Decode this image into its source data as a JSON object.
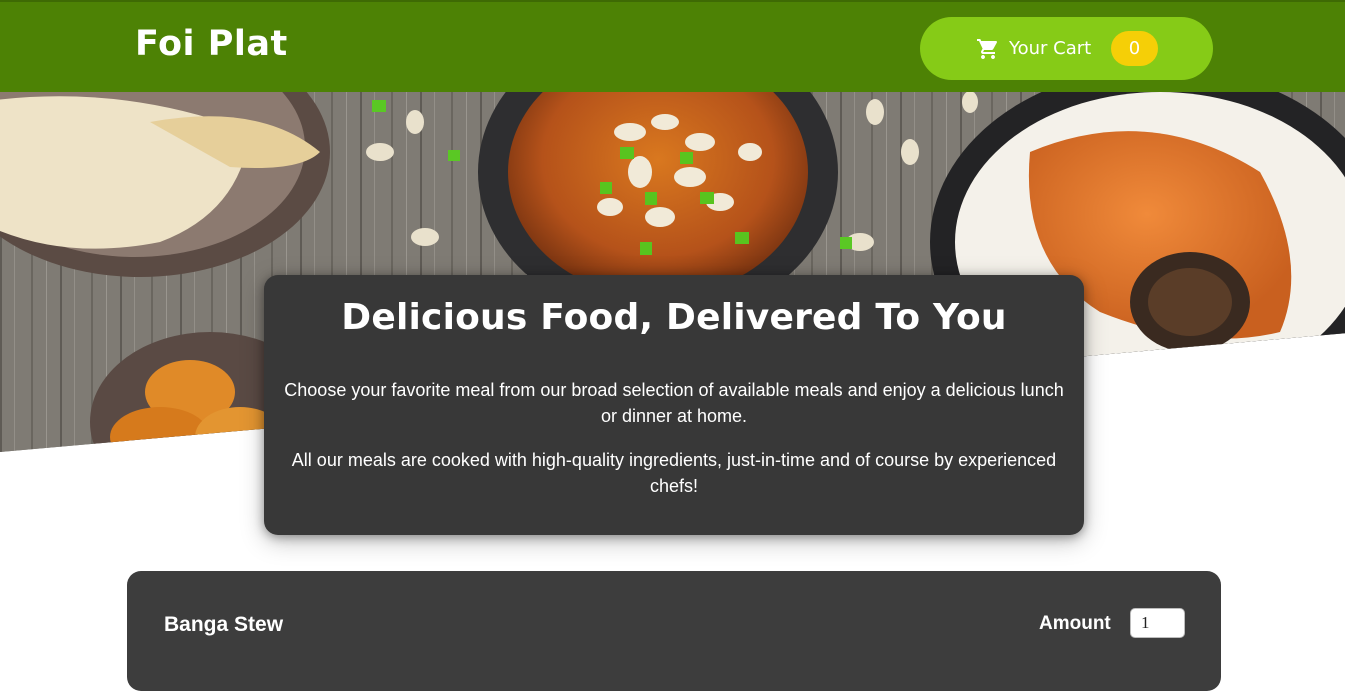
{
  "header": {
    "brand": "Foi Plat",
    "cart_label": "Your Cart",
    "cart_count": "0"
  },
  "intro": {
    "title": "Delicious Food, Delivered To You",
    "paragraph1": "Choose your favorite meal from our broad selection of available meals and enjoy a delicious lunch or dinner at home.",
    "paragraph2": "All our meals are cooked with high-quality ingredients, just-in-time and of course by experienced chefs!"
  },
  "meals": [
    {
      "name": "Banga Stew",
      "amount_label": "Amount",
      "amount_value": "1"
    }
  ],
  "colors": {
    "header_bg": "#4d8205",
    "cart_button": "#86cb17",
    "cart_badge": "#f5cf07",
    "card_bg": "#383838"
  },
  "icons": [
    "cart-icon"
  ]
}
